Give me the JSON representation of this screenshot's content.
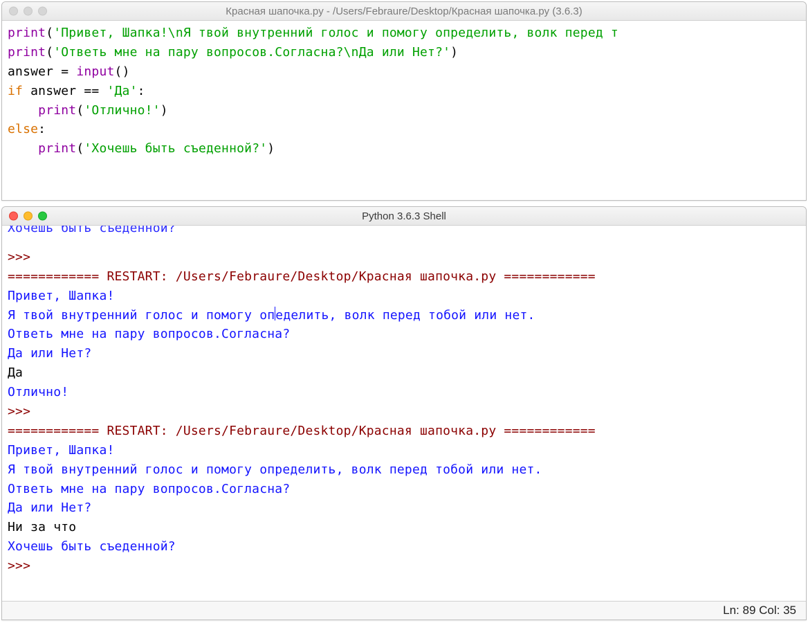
{
  "editor": {
    "title": "Красная шапочка.py - /Users/Febraure/Desktop/Красная шапочка.py (3.6.3)",
    "code": {
      "l1_print": "print",
      "l1_str": "'Привет, Шапка!\\nЯ твой внутренний голос и помогу определить, волк перед т",
      "l2_print": "print",
      "l2_str": "'Ответь мне на пару вопросов.Согласна?\\nДа или Нет?'",
      "l3_plain": "answer = ",
      "l3_input": "input",
      "l3_tail": "()",
      "l4_if": "if",
      "l4_cond_a": " answer == ",
      "l4_cond_str": "'Да'",
      "l4_colon": ":",
      "l5_indent": "    ",
      "l5_print": "print",
      "l5_str": "'Отлично!'",
      "l6_else": "else",
      "l6_colon": ":",
      "l7_indent": "    ",
      "l7_print": "print",
      "l7_str": "'Хочешь быть съеденной?'"
    }
  },
  "shell": {
    "title": "Python 3.6.3 Shell",
    "topCropped": "Хочешь быть съеденной?",
    "prompt": ">>> ",
    "restart": "============ RESTART: /Users/Febraure/Desktop/Красная шапочка.py ============",
    "out1": "Привет, Шапка!",
    "out2a": "Я твой внутренний голос и помогу оп",
    "out2b": "еделить, волк перед тобой или нет.",
    "out2full": "Я твой внутренний голос и помогу определить, волк перед тобой или нет.",
    "out3": "Ответь мне на пару вопросов.Согласна?",
    "out4": "Да или Нет?",
    "inp1": "Да",
    "res1": "Отлично!",
    "inp2": "Ни за что",
    "res2": "Хочешь быть съеденной?",
    "status": "Ln: 89  Col: 35"
  }
}
